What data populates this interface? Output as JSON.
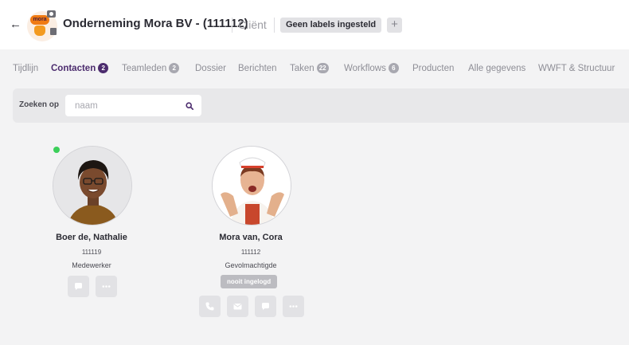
{
  "header": {
    "title": "Onderneming Mora BV - (111112)",
    "type": "Cliënt",
    "label_pill": "Geen labels ingesteld",
    "add_label": "+",
    "logo_text": "mora"
  },
  "tabs": [
    {
      "label": "Tijdlijn",
      "count": null,
      "active": false
    },
    {
      "label": "Contacten",
      "count": "2",
      "active": true
    },
    {
      "label": "Teamleden",
      "count": "2",
      "active": false
    },
    {
      "label": "Dossier",
      "count": null,
      "active": false
    },
    {
      "label": "Berichten",
      "count": null,
      "active": false
    },
    {
      "label": "Taken",
      "count": "22",
      "active": false
    },
    {
      "label": "Workflows",
      "count": "6",
      "active": false
    },
    {
      "label": "Producten",
      "count": null,
      "active": false
    },
    {
      "label": "Alle gegevens",
      "count": null,
      "active": false
    },
    {
      "label": "WWFT & Structuur",
      "count": null,
      "active": false
    }
  ],
  "search": {
    "label": "Zoeken op",
    "placeholder": "naam",
    "value": ""
  },
  "contacts": [
    {
      "name": "Boer de, Nathalie",
      "number": "111119",
      "role": "Medewerker",
      "online": true,
      "status": null,
      "actions": [
        "chat-icon",
        "more-icon"
      ]
    },
    {
      "name": "Mora van, Cora",
      "number": "111112",
      "role": "Gevolmachtigde",
      "online": false,
      "status": "nooit ingelogd",
      "actions": [
        "phone-icon",
        "mail-icon",
        "chat-icon",
        "more-icon"
      ]
    }
  ],
  "colors": {
    "accent": "#4c2c6e",
    "online": "#3ccf5a",
    "brand_orange": "#f07a12"
  }
}
